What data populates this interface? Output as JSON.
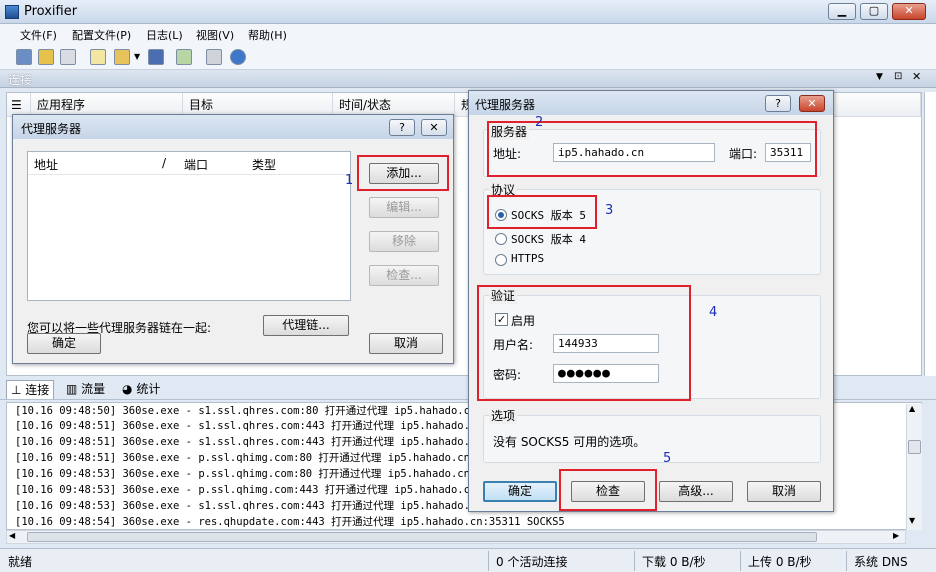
{
  "app": {
    "title": "Proxifier"
  },
  "menu": [
    "文件(F)",
    "配置文件(P)",
    "日志(L)",
    "视图(V)",
    "帮助(H)"
  ],
  "connections_panel": {
    "title": "连接",
    "columns": [
      "应用程序",
      "目标",
      "时间/状态",
      "规"
    ]
  },
  "bottom_tabs": [
    "连接",
    "流量",
    "统计"
  ],
  "log_lines": [
    "[10.16 09:48:50] 360se.exe - s1.ssl.qhres.com:80 打开通过代理 ip5.hahado.cn",
    "[10.16 09:48:51] 360se.exe - s1.ssl.qhres.com:443 打开通过代理 ip5.hahado.cn",
    "[10.16 09:48:51] 360se.exe - s1.ssl.qhres.com:443 打开通过代理 ip5.hahado.cn",
    "[10.16 09:48:51] 360se.exe - p.ssl.qhimg.com:80 打开通过代理 ip5.hahado.cn:3",
    "[10.16 09:48:53] 360se.exe - p.ssl.qhimg.com:80 打开通过代理 ip5.hahado.cn:3",
    "[10.16 09:48:53] 360se.exe - p.ssl.qhimg.com:443 打开通过代理 ip5.hahado.cn",
    "[10.16 09:48:53] 360se.exe - s1.ssl.qhres.com:443 打开通过代理 ip5.hahado.cn",
    "[10.16 09:48:54] 360se.exe - res.qhupdate.com:443 打开通过代理 ip5.hahado.cn:35311 SOCKS5"
  ],
  "statusbar": {
    "ready": "就绪",
    "active": "0 个活动连接",
    "download": "下载 0 B/秒",
    "upload": "上传 0 B/秒",
    "dns": "系统 DNS"
  },
  "servers_dialog": {
    "title": "代理服务器",
    "columns": {
      "address": "地址",
      "sep": "/",
      "port": "端口",
      "type": "类型"
    },
    "buttons": {
      "add": "添加...",
      "edit": "编辑...",
      "remove": "移除",
      "check": "检查...",
      "chain": "代理链...",
      "ok": "确定",
      "cancel": "取消"
    },
    "chain_hint": "您可以将一些代理服务器链在一起:",
    "annotation": "1"
  },
  "edit_dialog": {
    "title": "代理服务器",
    "server_group": "服务器",
    "address_label": "地址:",
    "address_value": "ip5.hahado.cn",
    "port_label": "端口:",
    "port_value": "35311",
    "protocol_group": "协议",
    "protocols": [
      "SOCKS 版本 5",
      "SOCKS 版本 4",
      "HTTPS"
    ],
    "auth_group": "验证",
    "enable_label": "启用",
    "username_label": "用户名:",
    "username_value": "144933",
    "password_label": "密码:",
    "password_value": "●●●●●●",
    "options_group": "选项",
    "options_text": "没有 SOCKS5 可用的选项。",
    "buttons": {
      "ok": "确定",
      "check": "检查",
      "advanced": "高级...",
      "cancel": "取消"
    },
    "annotations": [
      "2",
      "3",
      "4",
      "5"
    ]
  },
  "colors": {
    "highlight": "#e0202a",
    "annotation": "#1d2fb8"
  }
}
